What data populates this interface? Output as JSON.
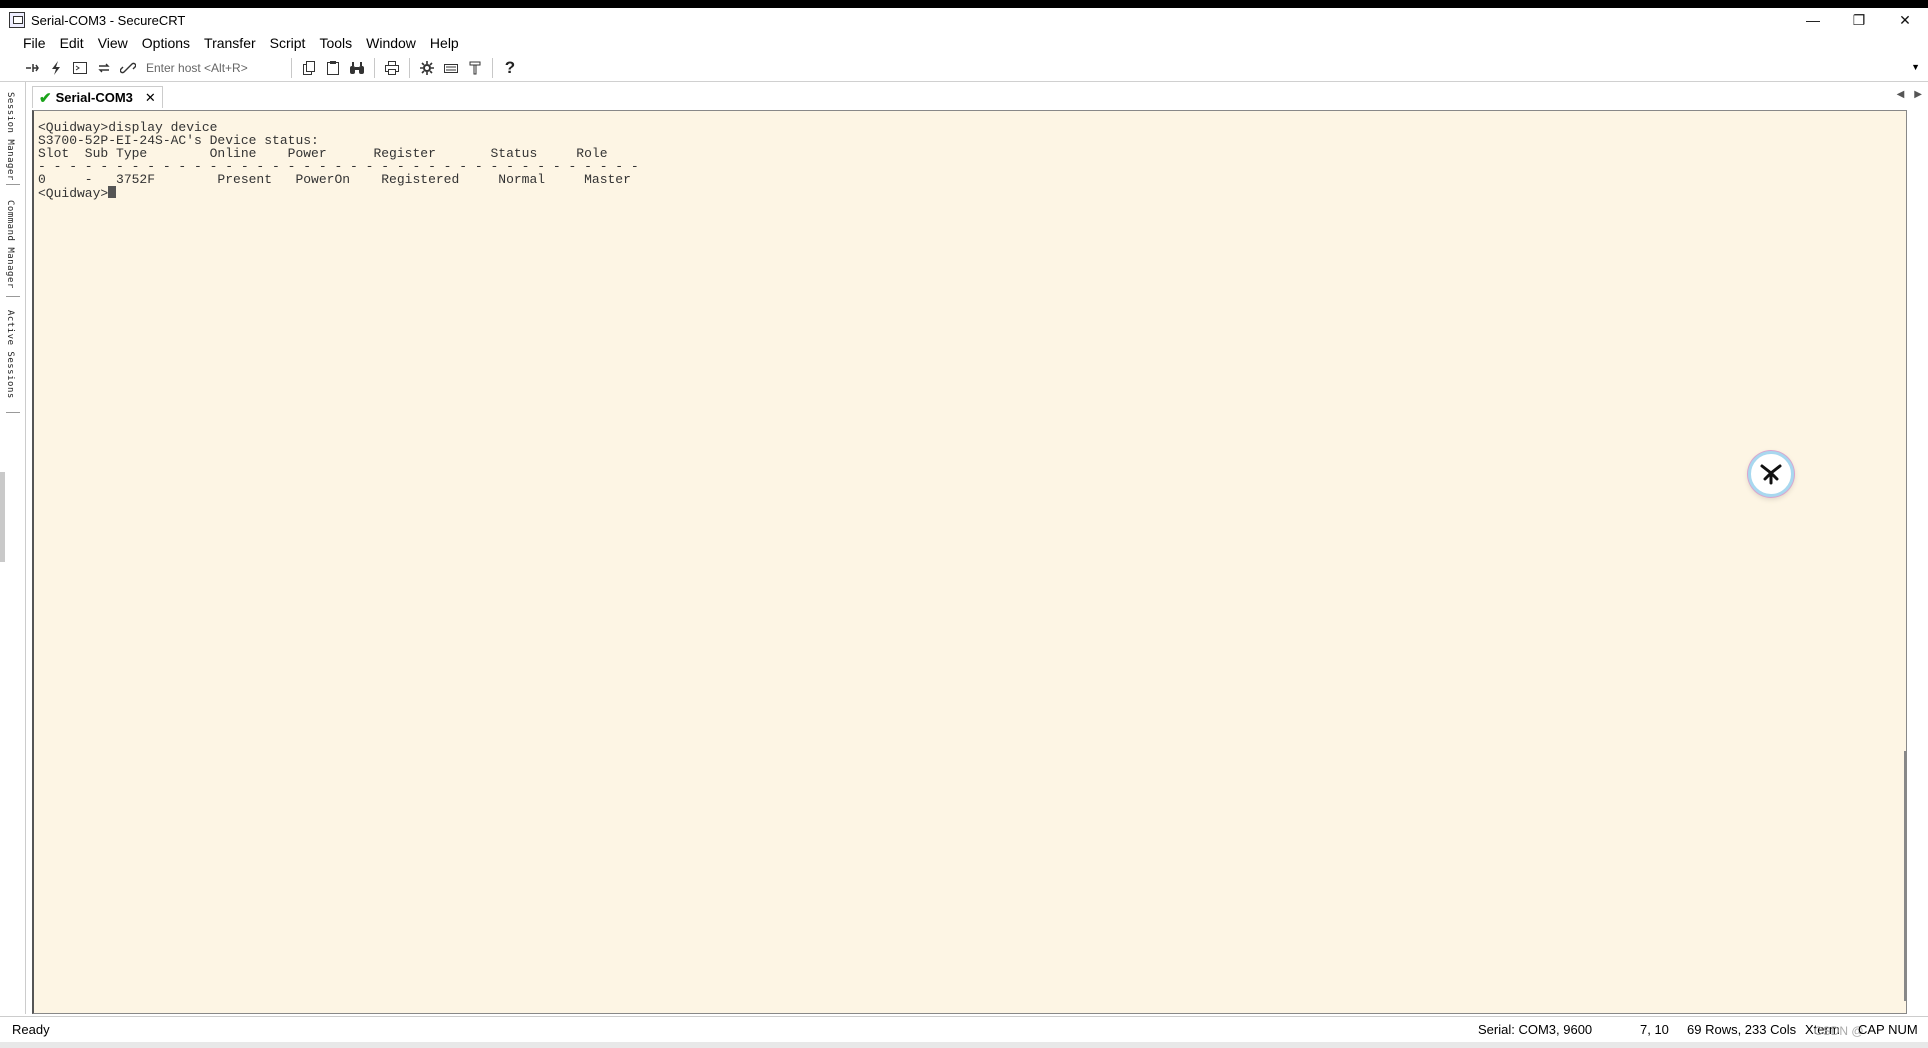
{
  "window": {
    "title": "Serial-COM3 - SecureCRT",
    "minimize_glyph": "—",
    "maximize_glyph": "❐",
    "close_glyph": "✕"
  },
  "menu": [
    "File",
    "Edit",
    "View",
    "Options",
    "Transfer",
    "Script",
    "Tools",
    "Window",
    "Help"
  ],
  "toolbar": {
    "host_placeholder": "Enter host <Alt+R>",
    "icons_left": [
      "connect-icon",
      "quick-connect-icon",
      "connect-in-tab-icon",
      "reconnect-icon",
      "disconnect-icon"
    ],
    "icons_mid": [
      "copy-icon",
      "paste-icon",
      "find-icon",
      "print-icon",
      "session-options-icon",
      "keymap-icon",
      "sftp-icon"
    ],
    "help_glyph": "?"
  },
  "sidebar": {
    "tabs": [
      "Session Manager",
      "Command Manager",
      "Active Sessions"
    ]
  },
  "session_tab": {
    "label": "Serial-COM3",
    "close_glyph": "✕"
  },
  "terminal": {
    "lines": [
      "<Quidway>display device",
      "S3700-52P-EI-24S-AC's Device status:",
      "Slot  Sub Type        Online    Power      Register       Status     Role",
      "- - - - - - - - - - - - - - - - - - - - - - - - - - - - - - - - - - - - - - -",
      "0     -   3752F        Present   PowerOn    Registered     Normal     Master"
    ],
    "prompt": "<Quidway>"
  },
  "status": {
    "ready": "Ready",
    "connection": "Serial: COM3, 9600",
    "cursor_pos": "7, 10",
    "size": "69 Rows, 233 Cols",
    "emulation": "Xterm",
    "caps_num": "CAP NUM",
    "watermark": "CSDN @"
  },
  "colors": {
    "terminal_bg": "#fdf5e4",
    "tab_check": "#1aa31a"
  }
}
